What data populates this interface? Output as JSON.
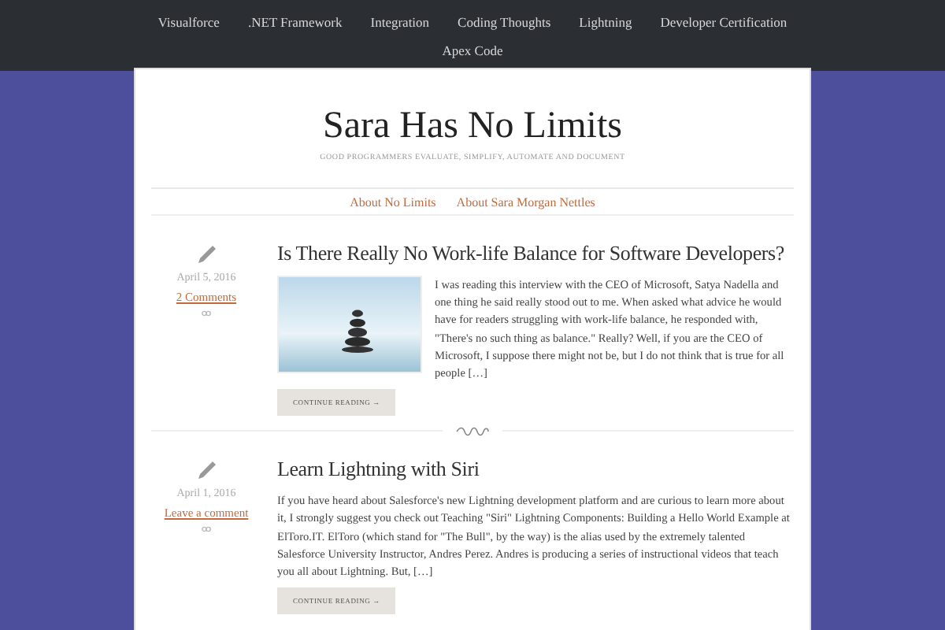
{
  "top_nav": {
    "items": [
      {
        "label": "Visualforce"
      },
      {
        "label": ".NET Framework"
      },
      {
        "label": "Integration"
      },
      {
        "label": "Coding Thoughts"
      },
      {
        "label": "Lightning"
      },
      {
        "label": "Developer Certification"
      },
      {
        "label": "Apex Code"
      }
    ]
  },
  "site": {
    "title": "Sara Has No Limits",
    "tagline": "GOOD PROGRAMMERS EVALUATE, SIMPLIFY, AUTOMATE AND DOCUMENT"
  },
  "page_nav": {
    "items": [
      {
        "label": "About No Limits"
      },
      {
        "label": "About Sara Morgan Nettles"
      }
    ]
  },
  "posts": [
    {
      "title": "Is There Really No Work-life Balance for Software Developers?",
      "date": "April 5, 2016",
      "comments": "2 Comments",
      "kind": "with_image",
      "excerpt": "I was reading this interview with the CEO of Microsoft, Satya Nadella and one thing he said really stood out to me. When asked what advice he would have for readers struggling with work-life balance, he responded with, \"There's no such thing as balance.\" Really? Well, if you are the CEO of Microsoft, I suppose there might not be, but I do not think that is true for all people […]",
      "button": "CONTINUE READING →"
    },
    {
      "title": "Learn Lightning with Siri",
      "date": "April 1, 2016",
      "comments": "Leave a comment",
      "kind": "text_only",
      "excerpt": "If you have heard about Salesforce's new Lightning development platform and are curious to learn more about it, I strongly suggest you check out Teaching \"Siri\" Lightning Components: Building a Hello World Example at ElToro.IT. ElToro (which stand for \"The Bull\", by the way) is the alias used by the extremely talented Salesforce University Instructor, Andres Perez. Andres is producing a series of instructional videos that teach you all about Lightning. But, […]",
      "button": "CONTINUE READING →"
    }
  ]
}
